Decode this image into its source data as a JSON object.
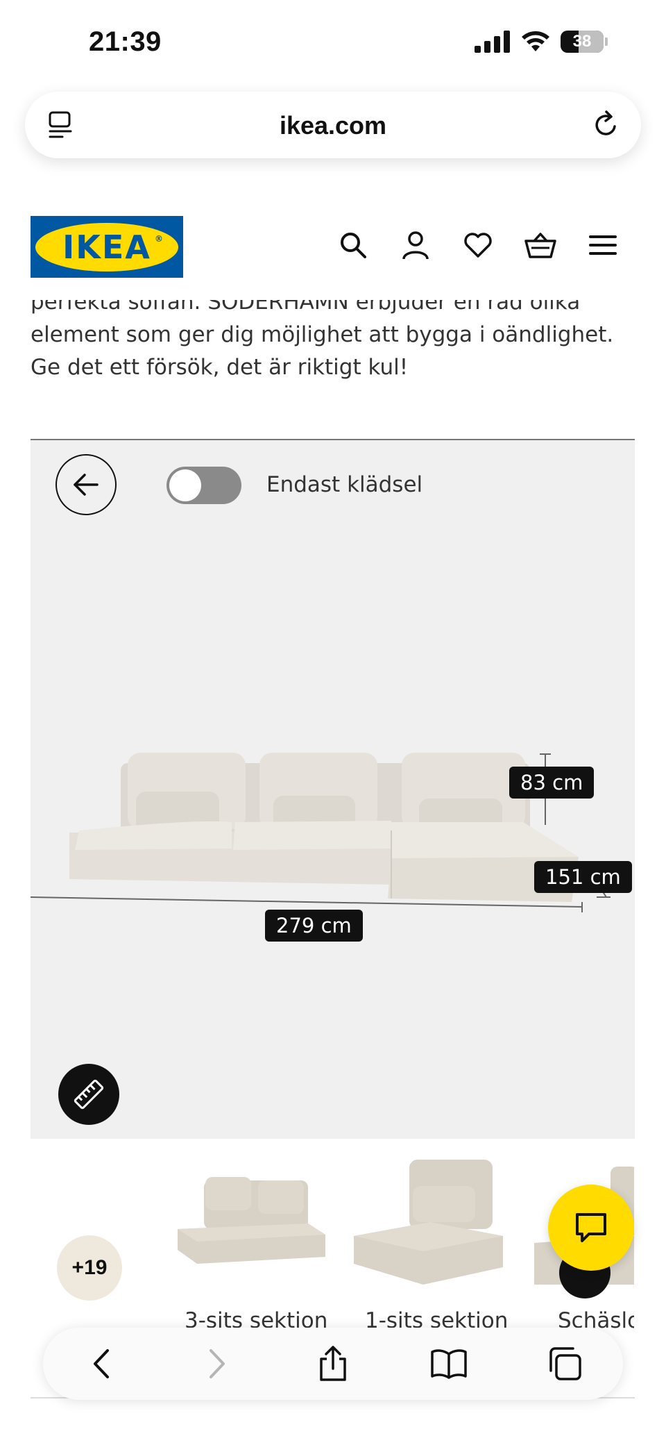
{
  "status_bar": {
    "time": "21:39",
    "battery": "38"
  },
  "browser": {
    "url": "ikea.com"
  },
  "header": {
    "logo_text": "IKEA"
  },
  "description": {
    "text_cut": "perfekta soffan. SÖDERHAMN erbjuder en rad olika",
    "text": "element som ger dig möjlighet att bygga i oändlighet. Ge det ett försök, det är riktigt kul!"
  },
  "viewer": {
    "toggle_label": "Endast klädsel",
    "toggle_on": false,
    "dimensions": {
      "height": "83 cm",
      "depth": "151 cm",
      "width": "279 cm"
    }
  },
  "thumbnails": {
    "more_count": "+19",
    "items": [
      {
        "label": "3-sits sektion"
      },
      {
        "label": "1-sits sektion"
      },
      {
        "label": "Schäslo"
      }
    ]
  },
  "colors": {
    "ikea_blue": "#0058a3",
    "ikea_yellow": "#ffdb00",
    "viewer_bg": "#f0f0f0"
  }
}
